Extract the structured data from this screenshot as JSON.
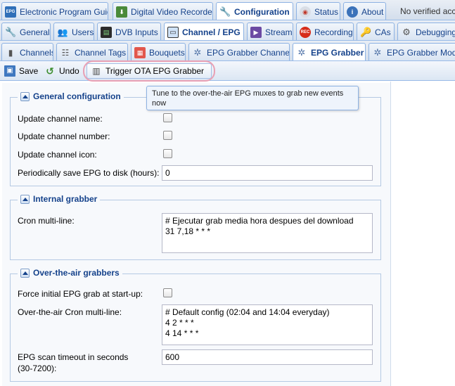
{
  "tabs_row1": [
    {
      "label": "Electronic Program Guide",
      "icon": "epg-icon"
    },
    {
      "label": "Digital Video Recorder",
      "icon": "dvr-icon"
    },
    {
      "label": "Configuration",
      "icon": "wrench-icon",
      "active": true
    },
    {
      "label": "Status",
      "icon": "status-icon"
    },
    {
      "label": "About",
      "icon": "info-icon"
    }
  ],
  "login_status": "No verified acce",
  "tabs_row2": [
    {
      "label": "General",
      "icon": "general-icon"
    },
    {
      "label": "Users",
      "icon": "users-icon"
    },
    {
      "label": "DVB Inputs",
      "icon": "dvb-icon"
    },
    {
      "label": "Channel / EPG",
      "icon": "tv-icon",
      "active": true
    },
    {
      "label": "Stream",
      "icon": "stream-icon"
    },
    {
      "label": "Recording",
      "icon": "rec-icon"
    },
    {
      "label": "CAs",
      "icon": "key-icon"
    },
    {
      "label": "Debugging",
      "icon": "debug-icon"
    }
  ],
  "tabs_row3": [
    {
      "label": "Channels",
      "icon": "channels-icon"
    },
    {
      "label": "Channel Tags",
      "icon": "tags-icon"
    },
    {
      "label": "Bouquets",
      "icon": "bouquets-icon"
    },
    {
      "label": "EPG Grabber Channels",
      "icon": "grabber-channels-icon"
    },
    {
      "label": "EPG Grabber",
      "icon": "grabber-icon",
      "active": true
    },
    {
      "label": "EPG Grabber Module",
      "icon": "grabber-module-icon"
    }
  ],
  "toolbar": {
    "save_label": "Save",
    "undo_label": "Undo",
    "trigger_label": "Trigger OTA EPG Grabber"
  },
  "tooltip": "Tune to the over-the-air EPG muxes to grab new events now",
  "general": {
    "title": "General configuration",
    "update_name_label": "Update channel name:",
    "update_number_label": "Update channel number:",
    "update_icon_label": "Update channel icon:",
    "save_period_label": "Periodically save EPG to disk (hours):",
    "save_period_value": "0"
  },
  "internal": {
    "title": "Internal grabber",
    "cron_label": "Cron multi-line:",
    "cron_value": "# Ejecutar grab media hora despues del download\n31 7,18 * * *"
  },
  "ota": {
    "title": "Over-the-air grabbers",
    "force_label": "Force initial EPG grab at start-up:",
    "cron_label": "Over-the-air Cron multi-line:",
    "cron_value": "# Default config (02:04 and 14:04 everyday)\n4 2 * * *\n4 14 * * *",
    "timeout_label_1": "EPG scan timeout in seconds",
    "timeout_label_2": "(30-7200):",
    "timeout_value": "600"
  },
  "colors": {
    "accent": "#15428b",
    "highlight": "#e9a0b4"
  }
}
